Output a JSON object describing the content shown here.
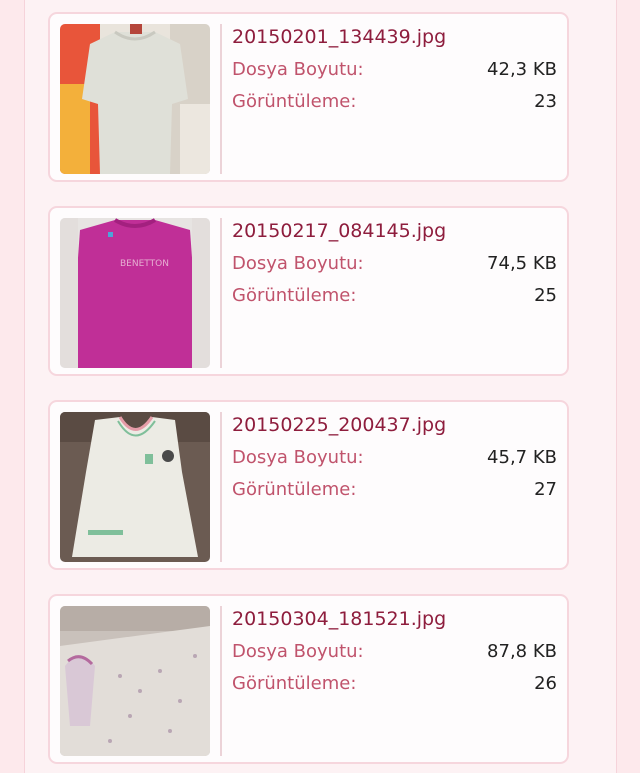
{
  "labels": {
    "size": "Dosya Boyutu:",
    "views": "Görüntüleme:"
  },
  "items": [
    {
      "filename": "20150201_134439.jpg",
      "size": "42,3 KB",
      "views": "23",
      "thumb": "white-tshirt"
    },
    {
      "filename": "20150217_084145.jpg",
      "size": "74,5 KB",
      "views": "25",
      "thumb": "pink-sweater",
      "thumb_text": "BENETTON"
    },
    {
      "filename": "20150225_200437.jpg",
      "size": "45,7 KB",
      "views": "27",
      "thumb": "white-dress"
    },
    {
      "filename": "20150304_181521.jpg",
      "size": "87,8 KB",
      "views": "26",
      "thumb": "patterned-onesie"
    }
  ],
  "colors": {
    "page_bg": "#fde9ec",
    "card_border": "#f6d6dd",
    "filename": "#8e1d3d",
    "label": "#c0536c"
  }
}
